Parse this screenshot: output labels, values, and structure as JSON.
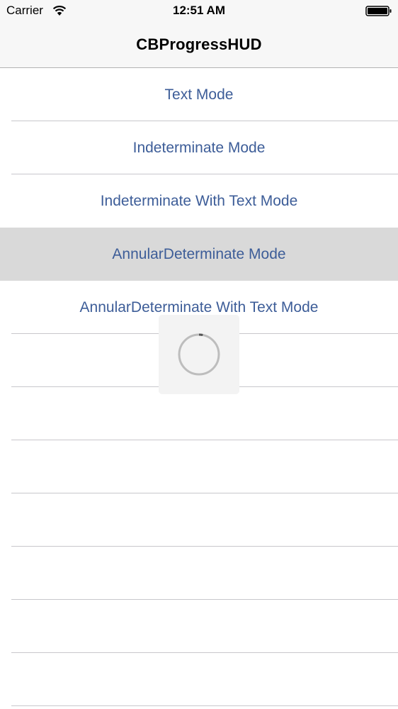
{
  "status_bar": {
    "carrier": "Carrier",
    "time": "12:51 AM",
    "wifi_icon": "wifi-icon",
    "battery_icon": "battery-icon"
  },
  "nav_bar": {
    "title": "CBProgressHUD"
  },
  "table": {
    "rows": [
      {
        "label": "Text Mode",
        "selected": false
      },
      {
        "label": "Indeterminate Mode",
        "selected": false
      },
      {
        "label": "Indeterminate With Text Mode",
        "selected": false
      },
      {
        "label": "AnnularDeterminate Mode",
        "selected": true
      },
      {
        "label": "AnnularDeterminate With Text Mode",
        "selected": false
      },
      {
        "label": "",
        "selected": false
      },
      {
        "label": "",
        "selected": false
      },
      {
        "label": "",
        "selected": false
      },
      {
        "label": "",
        "selected": false
      },
      {
        "label": "",
        "selected": false
      },
      {
        "label": "",
        "selected": false
      },
      {
        "label": "",
        "selected": false
      }
    ]
  },
  "hud": {
    "icon": "annular-progress-icon",
    "progress": 0.03
  },
  "colors": {
    "link_text": "#3d5d98",
    "selected_row": "#d9d9d9",
    "bar_background": "#f7f7f7"
  }
}
